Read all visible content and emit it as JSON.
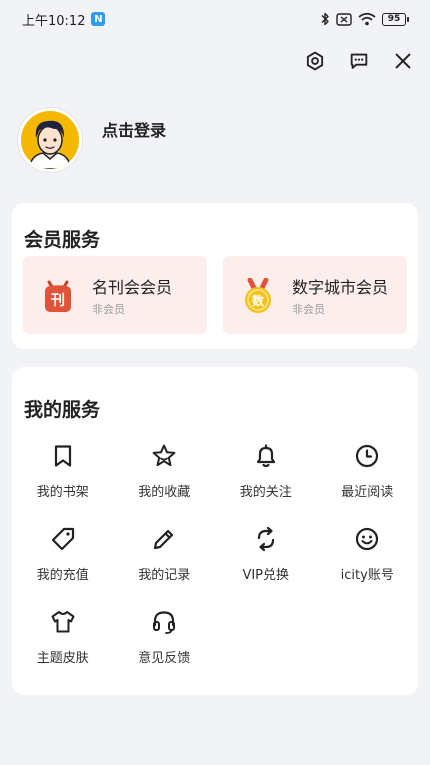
{
  "status_bar": {
    "time": "上午10:12",
    "notification_badge": "N",
    "battery": "95",
    "icons": [
      "bluetooth-icon",
      "sim-card-icon",
      "wifi-icon",
      "battery-icon"
    ]
  },
  "top_actions": [
    {
      "icon": "settings-icon"
    },
    {
      "icon": "message-icon"
    },
    {
      "icon": "close-icon"
    }
  ],
  "profile": {
    "avatar_icon": "user-avatar-icon",
    "login_text": "点击登录",
    "avatar_color": "#f5b800"
  },
  "member_services": {
    "title": "会员服务",
    "items": [
      {
        "name": "名刊会会员",
        "status": "非会员",
        "icon": "magazine-icon",
        "icon_text": "刊",
        "icon_color": "#e0533a"
      },
      {
        "name": "数字城市会员",
        "status": "非会员",
        "icon": "medal-icon",
        "icon_text": "数",
        "icon_color": "#f6c21a"
      }
    ],
    "tile_color": "#fdeeee"
  },
  "my_services": {
    "title": "我的服务",
    "items": [
      {
        "label": "我的书架",
        "icon": "bookmark-icon"
      },
      {
        "label": "我的收藏",
        "icon": "star-icon"
      },
      {
        "label": "我的关注",
        "icon": "bell-icon"
      },
      {
        "label": "最近阅读",
        "icon": "clock-icon"
      },
      {
        "label": "我的充值",
        "icon": "tag-icon"
      },
      {
        "label": "我的记录",
        "icon": "pencil-icon"
      },
      {
        "label": "VIP兑换",
        "icon": "exchange-icon"
      },
      {
        "label": "icity账号",
        "icon": "smiley-icon"
      },
      {
        "label": "主题皮肤",
        "icon": "tshirt-icon"
      },
      {
        "label": "意见反馈",
        "icon": "headset-icon"
      }
    ]
  }
}
